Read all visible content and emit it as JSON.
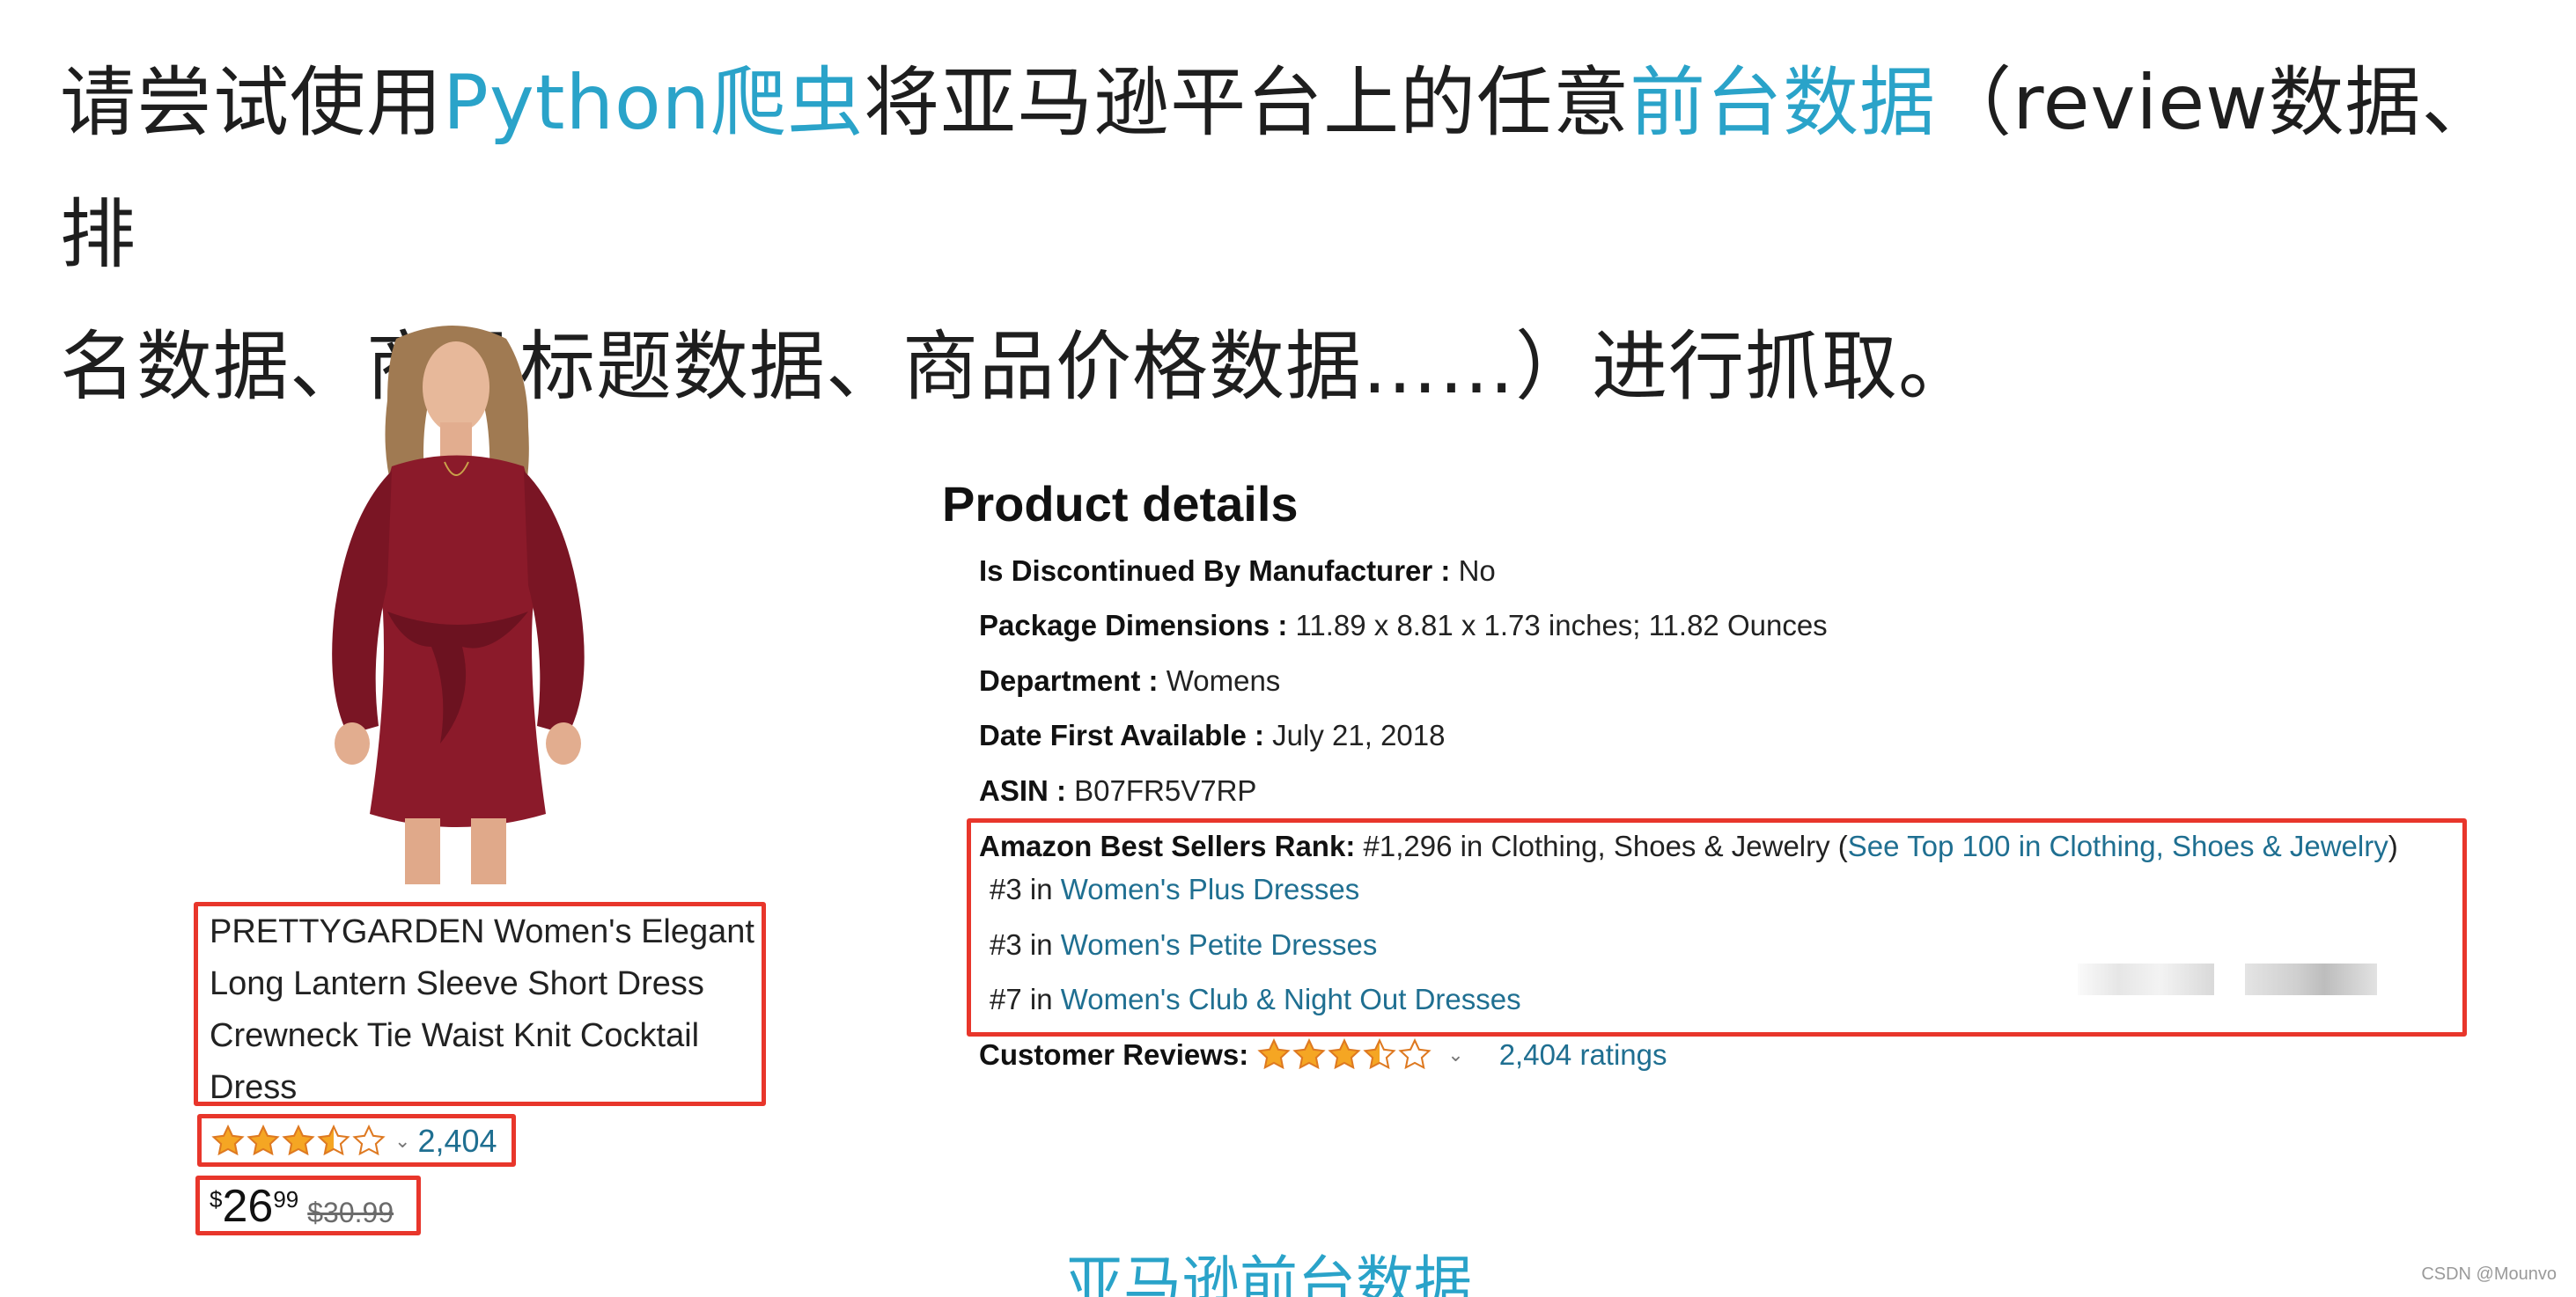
{
  "heading": {
    "part1": "请尝试使用",
    "part2": "Python爬虫",
    "part3": "将亚马逊平台上的任意",
    "part4": "前台数据",
    "part5": "（review数据、排",
    "line2": "名数据、商品标题数据、商品价格数据……）进行抓取。"
  },
  "product": {
    "image_alt": "red-dress-product-image",
    "title": "PRETTYGARDEN Women's Elegant Long Lantern Sleeve Short Dress Crewneck Tie Waist Knit Cocktail Dress",
    "title_lines": [
      "PRETTYGARDEN Women's Elegant",
      "Long Lantern Sleeve Short Dress",
      "Crewneck Tie Waist Knit Cocktail",
      "Dress"
    ],
    "rating_stars": 3.5,
    "rating_count": "2,404",
    "price_symbol": "$",
    "price_whole": "26",
    "price_fraction": "99",
    "price_old": "$30.99"
  },
  "details": {
    "title": "Product details",
    "rows": [
      {
        "label": "Is Discontinued By Manufacturer :",
        "value": "No"
      },
      {
        "label": "Package Dimensions :",
        "value": "11.89 x 8.81 x 1.73 inches; 11.82 Ounces"
      },
      {
        "label": "Department :",
        "value": "Womens"
      },
      {
        "label": "Date First Available :",
        "value": "July 21, 2018"
      },
      {
        "label": "ASIN :",
        "value": "B07FR5V7RP"
      }
    ],
    "rank_label": "Amazon Best Sellers Rank:",
    "rank_value": "#1,296 in Clothing, Shoes & Jewelry (",
    "rank_link": "See Top 100 in Clothing, Shoes & Jewelry",
    "rank_close": ")",
    "sub_ranks": [
      {
        "rank": "#3 in ",
        "category": "Women's Plus Dresses"
      },
      {
        "rank": "#3 in ",
        "category": "Women's Petite Dresses"
      },
      {
        "rank": "#7 in ",
        "category": "Women's Club & Night Out Dresses"
      }
    ],
    "reviews_label": "Customer Reviews:",
    "reviews_stars": 3.5,
    "reviews_link": "2,404 ratings"
  },
  "caption": "亚马逊前台数据",
  "watermark": "CSDN @Mounvo",
  "colors": {
    "highlight": "#2aa3c9",
    "link": "#1f6f91",
    "box_border": "#e8362b",
    "star": "#f5a623"
  }
}
